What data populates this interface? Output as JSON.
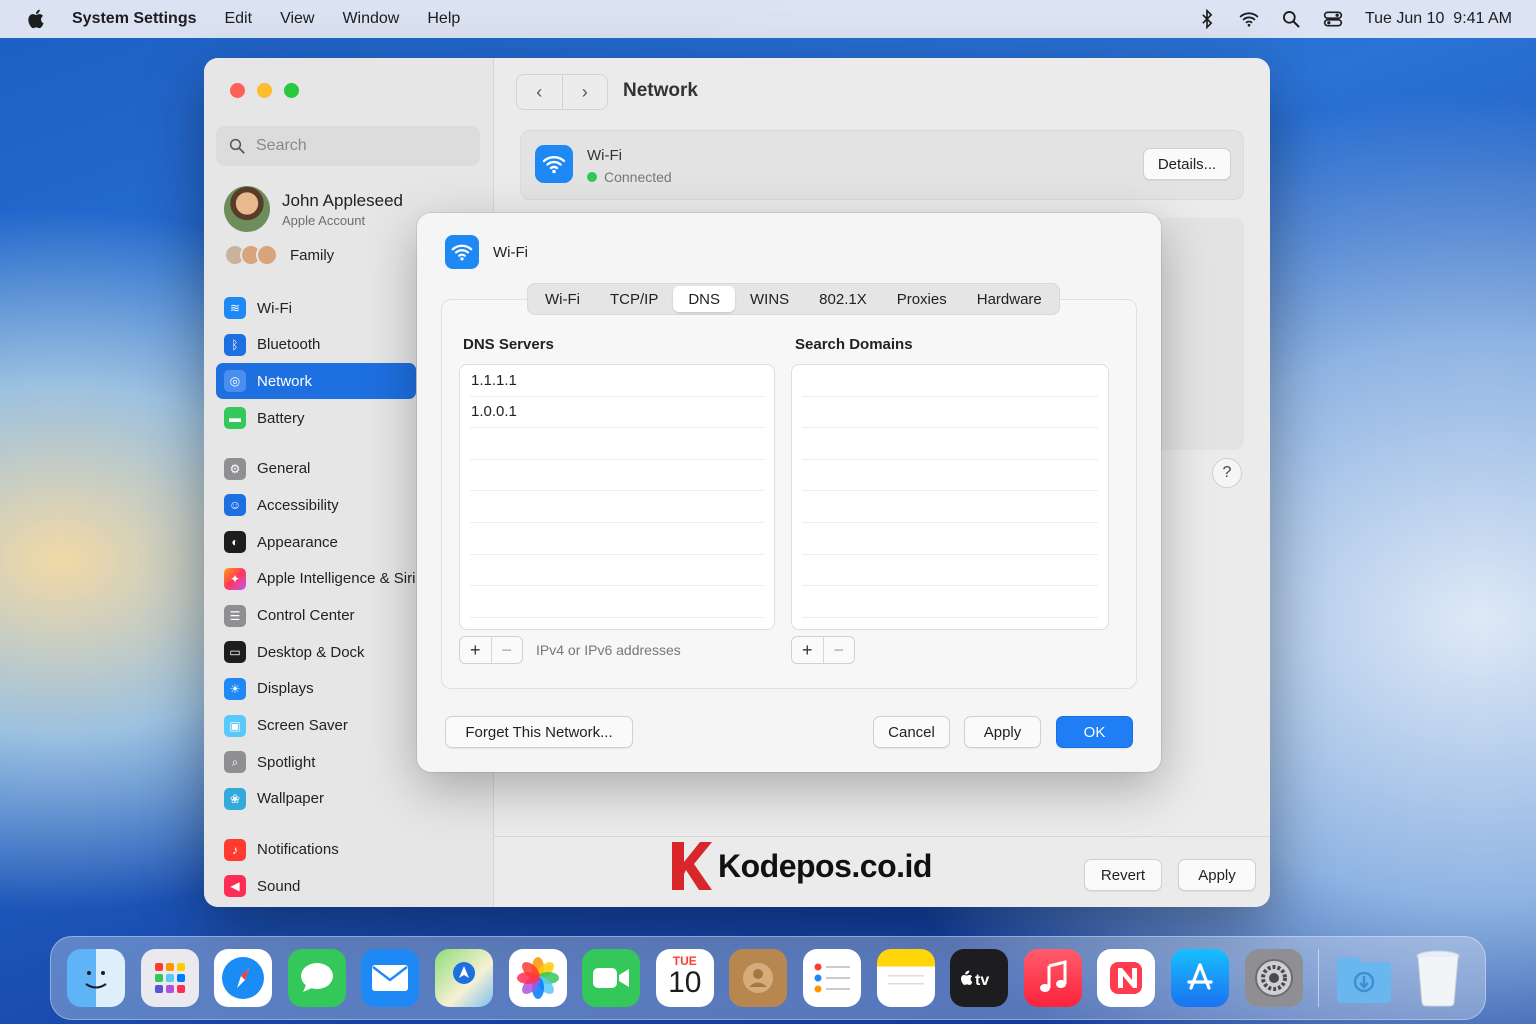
{
  "menubar": {
    "app_name": "System Settings",
    "items": [
      "Edit",
      "View",
      "Window",
      "Help"
    ],
    "datetime": "Tue Jun 10  9:41 AM"
  },
  "sidebar": {
    "search_placeholder": "Search",
    "user_name": "John Appleseed",
    "user_sub": "Apple Account",
    "family_label": "Family",
    "items": [
      {
        "label": "Wi-Fi",
        "color": "#1e88f5"
      },
      {
        "label": "Bluetooth",
        "color": "#1e6fe0"
      },
      {
        "label": "Network",
        "color": "#1e6fe0",
        "selected": true
      },
      {
        "label": "Battery",
        "color": "#34c759"
      },
      {
        "label": "General",
        "color": "#8e8e93"
      },
      {
        "label": "Accessibility",
        "color": "#1e6fe0"
      },
      {
        "label": "Appearance",
        "color": "#1d1d1f"
      },
      {
        "label": "Apple Intelligence & Siri",
        "color": "#ff6f61"
      },
      {
        "label": "Control Center",
        "color": "#8e8e93"
      },
      {
        "label": "Desktop & Dock",
        "color": "#1d1d1f"
      },
      {
        "label": "Displays",
        "color": "#1e88f5"
      },
      {
        "label": "Screen Saver",
        "color": "#5ac8fa"
      },
      {
        "label": "Spotlight",
        "color": "#8e8e93"
      },
      {
        "label": "Wallpaper",
        "color": "#34aadc"
      },
      {
        "label": "Notifications",
        "color": "#ff3b30"
      },
      {
        "label": "Sound",
        "color": "#ff2d55"
      }
    ]
  },
  "content": {
    "title": "Network",
    "wifi_name": "Wi-Fi",
    "wifi_status": "Connected",
    "details_label": "Details...",
    "help_label": "?",
    "revert_label": "Revert",
    "apply_label": "Apply"
  },
  "modal": {
    "title": "Wi-Fi",
    "tabs": [
      "Wi-Fi",
      "TCP/IP",
      "DNS",
      "WINS",
      "802.1X",
      "Proxies",
      "Hardware"
    ],
    "selected_tab": "DNS",
    "dns_title": "DNS Servers",
    "dns_servers": [
      "1.1.1.1",
      "1.0.0.1"
    ],
    "search_title": "Search Domains",
    "search_domains": [],
    "hint": "IPv4 or IPv6 addresses",
    "add_label": "+",
    "remove_label": "−",
    "forget_label": "Forget This Network...",
    "cancel_label": "Cancel",
    "apply_label": "Apply",
    "ok_label": "OK"
  },
  "watermark": {
    "text": "Kodepos.co.id"
  },
  "dock": {
    "calendar_month": "TUE",
    "calendar_day": "10",
    "apps": [
      "finder",
      "launchpad",
      "safari",
      "messages",
      "mail",
      "maps",
      "photos",
      "facetime",
      "calendar",
      "contacts",
      "reminders",
      "notes",
      "tv",
      "music",
      "news",
      "app-store",
      "system-settings",
      "downloads",
      "trash"
    ]
  },
  "colors": {
    "accent": "#1e6fe0",
    "ok": "#1f7ef5",
    "connected": "#32c759"
  }
}
